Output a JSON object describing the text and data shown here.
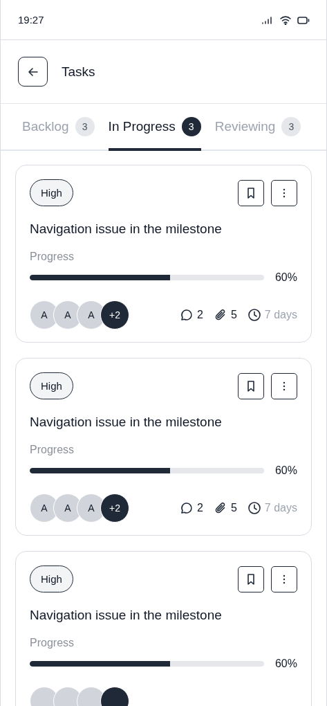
{
  "status_bar": {
    "time": "19:27"
  },
  "header": {
    "title": "Tasks"
  },
  "tabs": [
    {
      "label": "Backlog",
      "count": "3",
      "selected": false
    },
    {
      "label": "In Progress",
      "count": "3",
      "selected": true
    },
    {
      "label": "Reviewing",
      "count": "3",
      "selected": false
    }
  ],
  "cards": [
    {
      "priority": "High",
      "title": "Navigation issue in the milestone",
      "progress_label": "Progress",
      "level": 0.6,
      "reading": "60%",
      "avatars": [
        {
          "kind": "person",
          "label": "A"
        },
        {
          "kind": "person",
          "label": "A"
        },
        {
          "kind": "person",
          "label": "A"
        },
        {
          "kind": "more",
          "label": "+2"
        }
      ],
      "comments": "2",
      "attachments": "5",
      "due": "7 days"
    },
    {
      "priority": "High",
      "title": "Navigation issue in the milestone",
      "progress_label": "Progress",
      "level": 0.6,
      "reading": "60%",
      "avatars": [
        {
          "kind": "person",
          "label": "A"
        },
        {
          "kind": "person",
          "label": "A"
        },
        {
          "kind": "person",
          "label": "A"
        },
        {
          "kind": "more",
          "label": "+2"
        }
      ],
      "comments": "2",
      "attachments": "5",
      "due": "7 days"
    },
    {
      "priority": "High",
      "title": "Navigation issue in the milestone",
      "progress_label": "Progress",
      "level": 0.6,
      "reading": "60%",
      "avatars": [
        {
          "kind": "person"
        },
        {
          "kind": "person"
        },
        {
          "kind": "person"
        },
        {
          "kind": "more"
        }
      ]
    }
  ]
}
